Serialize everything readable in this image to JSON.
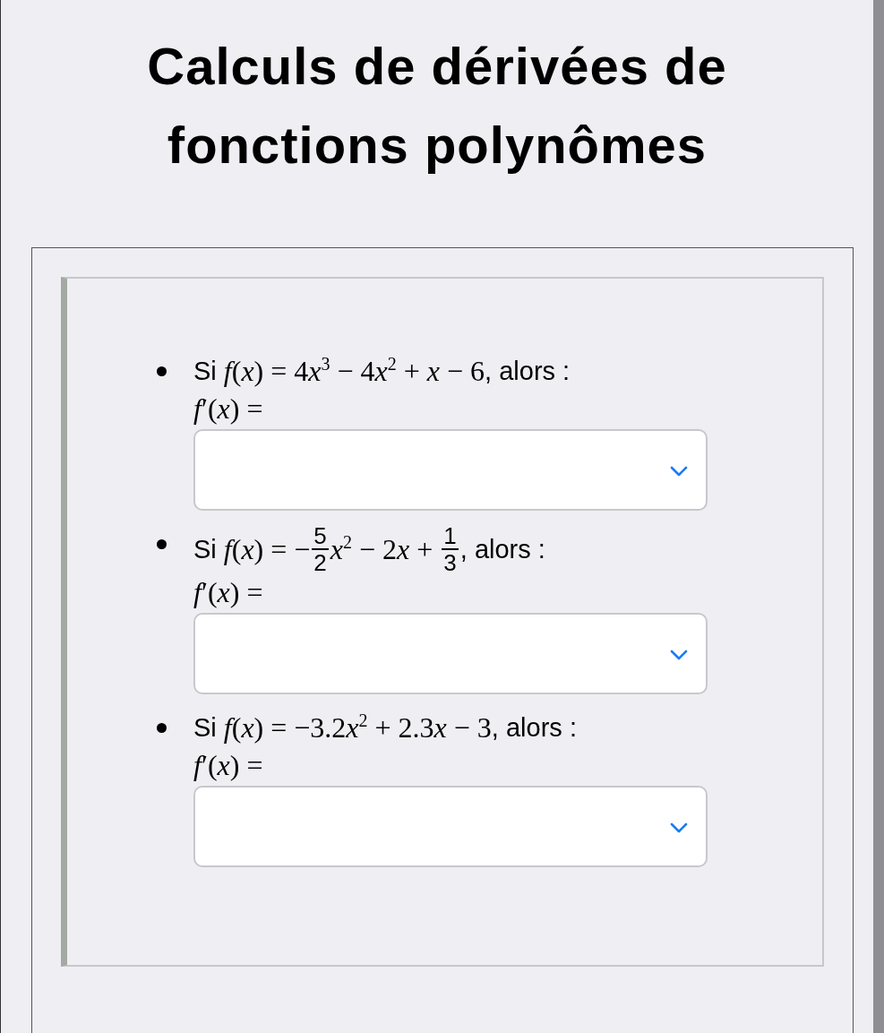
{
  "title": "Calculs de dérivées de fonctions polynômes",
  "questions": [
    {
      "prefix": "Si",
      "formula": [
        {
          "kind": "math",
          "text": "*f*(*x*) = 4"
        },
        {
          "kind": "var",
          "text": "x"
        },
        {
          "kind": "math",
          "text": "$^{3}$ − 4"
        },
        {
          "kind": "var",
          "text": "x"
        },
        {
          "kind": "math",
          "text": "$^{2}$ + *x* − 6"
        }
      ],
      "suffix": ", alors :",
      "answer_label": "*f*′(*x*) ="
    },
    {
      "prefix": "Si",
      "formula": [
        {
          "kind": "math",
          "text": "*f*(*x*) = −"
        },
        {
          "kind": "frac",
          "num": "5",
          "den": "2"
        },
        {
          "kind": "math",
          "text": "*x*$^{2}$ − 2"
        },
        {
          "kind": "var",
          "text": "x"
        },
        {
          "kind": "math",
          "text": " + "
        },
        {
          "kind": "frac",
          "num": "1",
          "den": "3"
        }
      ],
      "suffix": ", alors :",
      "answer_label": "*f*′(*x*) ="
    },
    {
      "prefix": "Si",
      "formula": [
        {
          "kind": "math",
          "text": "*f*(*x*) = −3.2"
        },
        {
          "kind": "var",
          "text": "x"
        },
        {
          "kind": "math",
          "text": "$^{2}$ + 2.3"
        },
        {
          "kind": "var",
          "text": "x"
        },
        {
          "kind": "math",
          "text": " − 3"
        }
      ],
      "suffix": ", alors :",
      "answer_label": "*f*′(*x*) ="
    }
  ]
}
